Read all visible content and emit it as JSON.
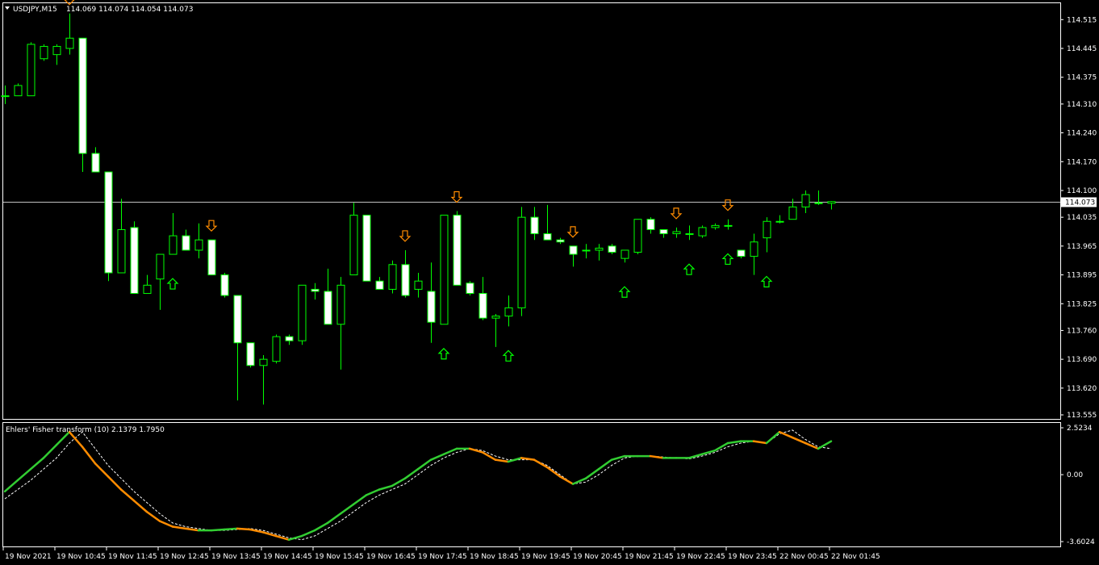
{
  "header": {
    "symbol": "USDJPY,M15",
    "ohlc": "114.069 114.074 114.054 114.073"
  },
  "indicator_header": "Ehlers' Fisher transform (10) 2.1379 1.7950",
  "colors": {
    "background": "#000000",
    "frame": "#ffffff",
    "up_wick": "#00ff00",
    "candle_body": "#ffffff",
    "arrow_up": "#00ff00",
    "arrow_down": "#ff8c00",
    "fisher_up": "#32cd32",
    "fisher_down": "#ff8c00",
    "signal": "#ffffff",
    "price_line": "#c0c0c0"
  },
  "chart_data": [
    {
      "type": "candlestick",
      "title": "USDJPY,M15",
      "y_ticks": [
        "114.515",
        "114.445",
        "114.375",
        "114.310",
        "114.240",
        "114.170",
        "114.100",
        "114.035",
        "113.965",
        "113.895",
        "113.825",
        "113.760",
        "113.690",
        "113.620",
        "113.555"
      ],
      "ylim": [
        113.555,
        114.545
      ],
      "current_price": "114.073",
      "x_tick_labels": [
        "19 Nov 2021",
        "19 Nov 10:45",
        "19 Nov 11:45",
        "19 Nov 12:45",
        "19 Nov 13:45",
        "19 Nov 14:45",
        "19 Nov 15:45",
        "19 Nov 16:45",
        "19 Nov 17:45",
        "19 Nov 18:45",
        "19 Nov 19:45",
        "19 Nov 20:45",
        "19 Nov 21:45",
        "19 Nov 22:45",
        "19 Nov 23:45",
        "22 Nov 00:45",
        "22 Nov 01:45"
      ],
      "candles": [
        [
          114.33,
          114.355,
          114.31,
          114.33
        ],
        [
          114.33,
          114.36,
          114.33,
          114.355
        ],
        [
          114.33,
          114.46,
          114.33,
          114.455
        ],
        [
          114.42,
          114.455,
          114.415,
          114.45
        ],
        [
          114.43,
          114.455,
          114.405,
          114.45
        ],
        [
          114.445,
          114.53,
          114.43,
          114.47
        ],
        [
          114.47,
          114.47,
          114.145,
          114.19
        ],
        [
          114.19,
          114.205,
          114.145,
          114.145
        ],
        [
          114.145,
          114.145,
          113.88,
          113.9
        ],
        [
          113.9,
          114.08,
          113.9,
          114.005
        ],
        [
          114.01,
          114.025,
          113.85,
          113.85
        ],
        [
          113.85,
          113.895,
          113.85,
          113.87
        ],
        [
          113.885,
          113.945,
          113.81,
          113.945
        ],
        [
          113.945,
          114.045,
          113.945,
          113.99
        ],
        [
          113.99,
          114.005,
          113.96,
          113.955
        ],
        [
          113.955,
          114.02,
          113.935,
          113.98
        ],
        [
          113.98,
          113.98,
          113.895,
          113.895
        ],
        [
          113.895,
          113.9,
          113.84,
          113.845
        ],
        [
          113.845,
          113.845,
          113.59,
          113.73
        ],
        [
          113.73,
          113.73,
          113.67,
          113.675
        ],
        [
          113.675,
          113.7,
          113.58,
          113.69
        ],
        [
          113.685,
          113.75,
          113.68,
          113.745
        ],
        [
          113.745,
          113.75,
          113.725,
          113.735
        ],
        [
          113.735,
          113.87,
          113.725,
          113.87
        ],
        [
          113.86,
          113.875,
          113.835,
          113.855
        ],
        [
          113.855,
          113.91,
          113.775,
          113.775
        ],
        [
          113.775,
          113.89,
          113.665,
          113.87
        ],
        [
          113.895,
          114.07,
          113.895,
          114.04
        ],
        [
          114.04,
          114.04,
          113.88,
          113.88
        ],
        [
          113.88,
          113.89,
          113.86,
          113.86
        ],
        [
          113.86,
          113.93,
          113.85,
          113.92
        ],
        [
          113.92,
          113.955,
          113.84,
          113.845
        ],
        [
          113.86,
          113.9,
          113.84,
          113.88
        ],
        [
          113.855,
          113.925,
          113.73,
          113.78
        ],
        [
          113.775,
          114.04,
          113.775,
          114.04
        ],
        [
          114.04,
          114.05,
          113.87,
          113.87
        ],
        [
          113.875,
          113.88,
          113.845,
          113.85
        ],
        [
          113.85,
          113.89,
          113.785,
          113.79
        ],
        [
          113.79,
          113.8,
          113.72,
          113.795
        ],
        [
          113.795,
          113.845,
          113.77,
          113.815
        ],
        [
          113.815,
          114.06,
          113.795,
          114.035
        ],
        [
          114.035,
          114.06,
          113.98,
          113.995
        ],
        [
          113.995,
          114.065,
          113.985,
          113.98
        ],
        [
          113.98,
          113.985,
          113.97,
          113.975
        ],
        [
          113.965,
          113.965,
          113.915,
          113.945
        ],
        [
          113.955,
          113.97,
          113.935,
          113.955
        ],
        [
          113.955,
          113.97,
          113.93,
          113.96
        ],
        [
          113.965,
          113.97,
          113.945,
          113.95
        ],
        [
          113.935,
          113.955,
          113.925,
          113.955
        ],
        [
          113.95,
          114.03,
          113.945,
          114.03
        ],
        [
          114.03,
          114.035,
          113.995,
          114.005
        ],
        [
          114.005,
          114.005,
          113.985,
          113.995
        ],
        [
          113.995,
          114.01,
          113.985,
          114.0
        ],
        [
          113.995,
          114.015,
          113.98,
          113.995
        ],
        [
          113.99,
          114.015,
          113.985,
          114.01
        ],
        [
          114.01,
          114.02,
          114.005,
          114.015
        ],
        [
          114.015,
          114.03,
          114.005,
          114.015
        ],
        [
          113.955,
          113.955,
          113.935,
          113.94
        ],
        [
          113.94,
          113.995,
          113.895,
          113.975
        ],
        [
          113.985,
          114.035,
          113.95,
          114.025
        ],
        [
          114.025,
          114.04,
          114.02,
          114.025
        ],
        [
          114.03,
          114.08,
          114.03,
          114.06
        ],
        [
          114.06,
          114.1,
          114.045,
          114.09
        ],
        [
          114.07,
          114.1,
          114.065,
          114.07
        ],
        [
          114.069,
          114.074,
          114.054,
          114.073
        ]
      ],
      "signal_arrows": [
        {
          "index": 5,
          "direction": "down"
        },
        {
          "index": 13,
          "direction": "up"
        },
        {
          "index": 16,
          "direction": "down"
        },
        {
          "index": 31,
          "direction": "down"
        },
        {
          "index": 34,
          "direction": "up"
        },
        {
          "index": 35,
          "direction": "down"
        },
        {
          "index": 39,
          "direction": "up"
        },
        {
          "index": 44,
          "direction": "down"
        },
        {
          "index": 48,
          "direction": "up"
        },
        {
          "index": 52,
          "direction": "down"
        },
        {
          "index": 53,
          "direction": "up"
        },
        {
          "index": 56,
          "direction": "up"
        },
        {
          "index": 56,
          "direction": "down"
        },
        {
          "index": 59,
          "direction": "up"
        }
      ]
    },
    {
      "type": "line",
      "title": "Ehlers' Fisher transform (10) 2.1379 1.7950",
      "y_ticks": [
        "2.5234",
        "0.00",
        "-3.6024"
      ],
      "ylim": [
        -3.6024,
        2.5234
      ],
      "series": [
        {
          "role": "fisher",
          "values": [
            -0.9,
            -0.3,
            0.3,
            0.9,
            1.6,
            2.3,
            1.5,
            0.6,
            -0.1,
            -0.8,
            -1.4,
            -2.0,
            -2.5,
            -2.8,
            -2.9,
            -3.0,
            -3.0,
            -2.95,
            -2.9,
            -2.95,
            -3.1,
            -3.3,
            -3.5,
            -3.3,
            -3.0,
            -2.6,
            -2.1,
            -1.6,
            -1.1,
            -0.8,
            -0.6,
            -0.2,
            0.3,
            0.8,
            1.1,
            1.4,
            1.4,
            1.2,
            0.8,
            0.7,
            0.9,
            0.8,
            0.4,
            -0.1,
            -0.5,
            -0.2,
            0.3,
            0.8,
            1.0,
            1.0,
            1.0,
            0.9,
            0.9,
            0.9,
            1.1,
            1.3,
            1.7,
            1.8,
            1.8,
            1.7,
            2.3,
            2.0,
            1.7,
            1.4,
            1.8
          ]
        },
        {
          "role": "signal",
          "values": [
            -1.3,
            -0.8,
            -0.3,
            0.3,
            0.9,
            1.7,
            2.3,
            1.4,
            0.5,
            -0.2,
            -0.9,
            -1.5,
            -2.1,
            -2.6,
            -2.8,
            -2.9,
            -3.0,
            -3.0,
            -2.95,
            -2.9,
            -3.0,
            -3.2,
            -3.4,
            -3.5,
            -3.3,
            -2.9,
            -2.5,
            -2.0,
            -1.5,
            -1.1,
            -0.8,
            -0.5,
            0.0,
            0.5,
            0.9,
            1.2,
            1.4,
            1.3,
            1.0,
            0.8,
            0.8,
            0.8,
            0.5,
            0.0,
            -0.5,
            -0.4,
            0.0,
            0.5,
            0.9,
            1.0,
            1.0,
            0.95,
            0.9,
            0.85,
            1.0,
            1.2,
            1.5,
            1.7,
            1.8,
            1.7,
            2.2,
            2.4,
            1.9,
            1.5,
            1.4
          ]
        }
      ]
    }
  ]
}
